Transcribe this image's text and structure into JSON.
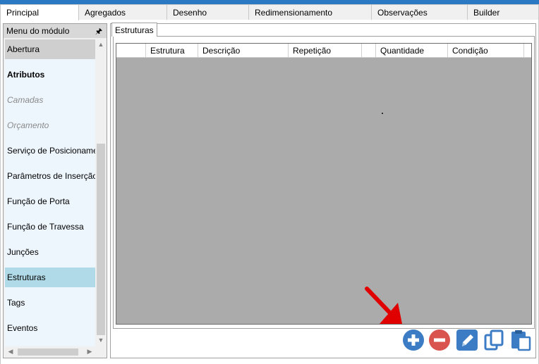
{
  "tabs": [
    {
      "label": "Principal"
    },
    {
      "label": "Agregados"
    },
    {
      "label": "Desenho"
    },
    {
      "label": "Redimensionamento"
    },
    {
      "label": "Observações"
    },
    {
      "label": "Builder"
    }
  ],
  "sidebar": {
    "title": "Menu do módulo",
    "items": [
      {
        "label": "Abertura"
      },
      {
        "label": "Atributos"
      },
      {
        "label": "Camadas"
      },
      {
        "label": "Orçamento"
      },
      {
        "label": "Serviço de Posicionamento"
      },
      {
        "label": "Parâmetros de Inserção"
      },
      {
        "label": "Função de Porta"
      },
      {
        "label": "Função de Travessa"
      },
      {
        "label": "Junções"
      },
      {
        "label": "Estruturas"
      },
      {
        "label": "Tags"
      },
      {
        "label": "Eventos"
      }
    ]
  },
  "subtab": {
    "label": "Estruturas"
  },
  "grid": {
    "columns": [
      {
        "label": ""
      },
      {
        "label": "Estrutura"
      },
      {
        "label": "Descrição"
      },
      {
        "label": "Repetição"
      },
      {
        "label": ""
      },
      {
        "label": "Quantidade"
      },
      {
        "label": "Condição"
      }
    ]
  },
  "colors": {
    "accent": "#2b79c2",
    "selected_item": "#b0dae8",
    "button_blue": "#3b7cc4",
    "button_red": "#d9534f",
    "grid_bg": "#ababab"
  },
  "toolbar": {
    "icons": [
      "plus-icon",
      "minus-icon",
      "pencil-icon",
      "copy-icon",
      "paste-icon"
    ]
  }
}
